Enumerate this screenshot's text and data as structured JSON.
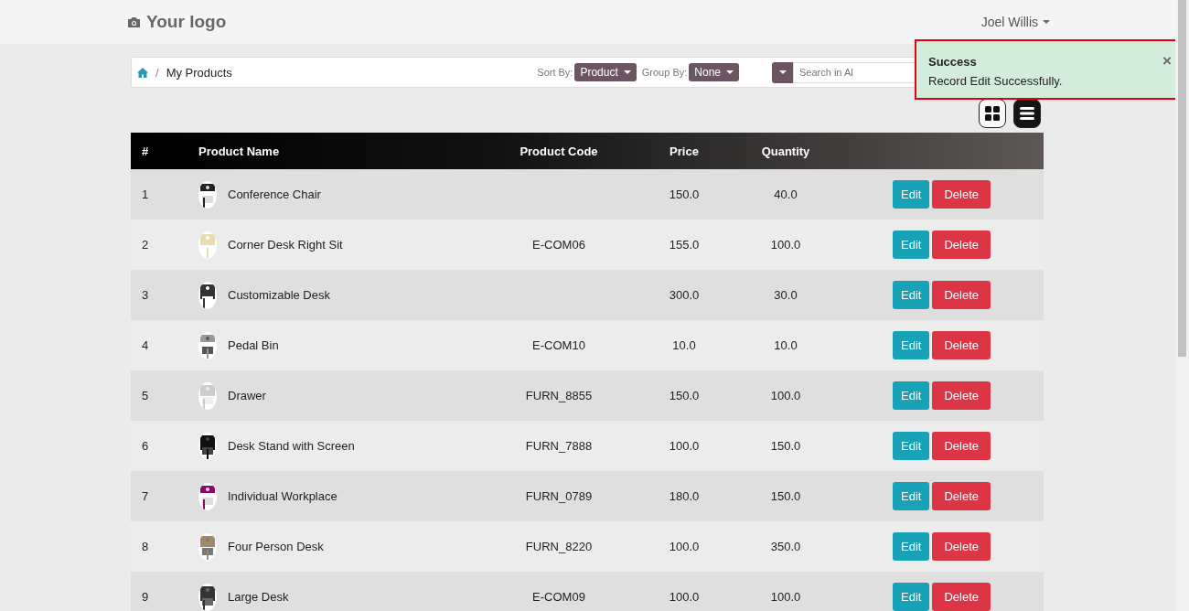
{
  "header": {
    "logo": "Your logo",
    "user": "Joel Willis"
  },
  "breadcrumb": {
    "separator": "/",
    "current": "My Products"
  },
  "controls": {
    "sort_label": "Sort By:",
    "sort_value": "Product",
    "group_label": "Group By:",
    "group_value": "None",
    "search_placeholder": "Search in Al"
  },
  "views": [
    {
      "kind": "grid",
      "selected": false
    },
    {
      "kind": "list",
      "selected": true
    }
  ],
  "toast": {
    "title": "Success",
    "message": "Record Edit Successfully.",
    "close": "×"
  },
  "table": {
    "columns": [
      "#",
      "Product Name",
      "Product Code",
      "Price",
      "Quantity"
    ],
    "rows": [
      {
        "num": "1",
        "name": "Conference Chair",
        "code": "",
        "price": "150.0",
        "quantity": "40.0",
        "edit": "Edit",
        "delete": "Delete"
      },
      {
        "num": "2",
        "name": "Corner Desk Right Sit",
        "code": "E-COM06",
        "price": "155.0",
        "quantity": "100.0",
        "edit": "Edit",
        "delete": "Delete"
      },
      {
        "num": "3",
        "name": "Customizable Desk",
        "code": "",
        "price": "300.0",
        "quantity": "30.0",
        "edit": "Edit",
        "delete": "Delete"
      },
      {
        "num": "4",
        "name": "Pedal Bin",
        "code": "E-COM10",
        "price": "10.0",
        "quantity": "10.0",
        "edit": "Edit",
        "delete": "Delete"
      },
      {
        "num": "5",
        "name": "Drawer",
        "code": "FURN_8855",
        "price": "150.0",
        "quantity": "100.0",
        "edit": "Edit",
        "delete": "Delete"
      },
      {
        "num": "6",
        "name": "Desk Stand with Screen",
        "code": "FURN_7888",
        "price": "100.0",
        "quantity": "150.0",
        "edit": "Edit",
        "delete": "Delete"
      },
      {
        "num": "7",
        "name": "Individual Workplace",
        "code": "FURN_0789",
        "price": "180.0",
        "quantity": "150.0",
        "edit": "Edit",
        "delete": "Delete"
      },
      {
        "num": "8",
        "name": "Four Person Desk",
        "code": "FURN_8220",
        "price": "100.0",
        "quantity": "350.0",
        "edit": "Edit",
        "delete": "Delete"
      },
      {
        "num": "9",
        "name": "Large Desk",
        "code": "E-COM09",
        "price": "100.0",
        "quantity": "100.0",
        "edit": "Edit",
        "delete": "Delete"
      }
    ]
  }
}
